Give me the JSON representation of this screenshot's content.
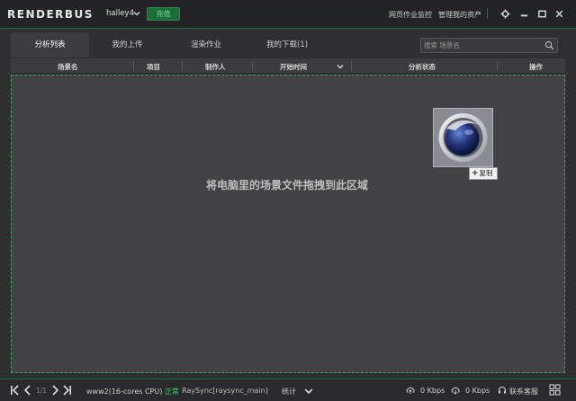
{
  "titlebar": {
    "logo_prefix": "Render",
    "logo_suffix": "Bus",
    "username": "halley4",
    "recharge_label": "充值",
    "link_monitor": "网页作业监控",
    "link_assets": "管理我的资产"
  },
  "tabs": [
    {
      "label": "分析列表"
    },
    {
      "label": "我的上传"
    },
    {
      "label": "渲染作业"
    },
    {
      "label": "我的下载(1)"
    }
  ],
  "search": {
    "placeholder": "搜索 场景名"
  },
  "table": {
    "headers": [
      "场景名",
      "项目",
      "制作人",
      "开始时间",
      "分析状态",
      "操作"
    ]
  },
  "dropzone": {
    "hint": "将电脑里的场景文件拖拽到此区域",
    "copy_plus": "+",
    "copy_label": "复制"
  },
  "statusbar": {
    "page": "1/1",
    "machine": "www2(16-cores CPU)",
    "machine_status": "正常",
    "transfer": "RaySync[raysync_main]",
    "stats_label": "统计",
    "upload_speed": "0 Kbps",
    "download_speed": "0 Kbps",
    "support_label": "联系客服"
  },
  "colors": {
    "accent_green": "#3fd06a",
    "dropzone_border": "#3ca25a"
  }
}
